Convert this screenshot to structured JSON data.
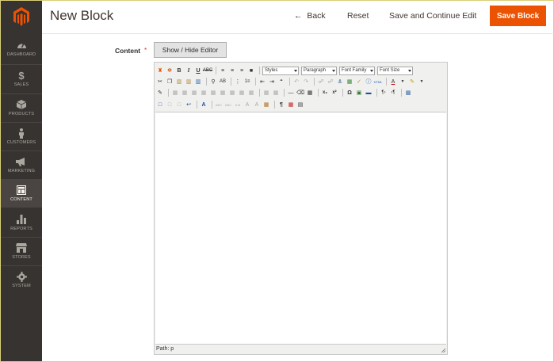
{
  "sidebar": {
    "items": [
      {
        "label": "DASHBOARD",
        "icon": "dashboard-icon"
      },
      {
        "label": "SALES",
        "icon": "dollar-icon"
      },
      {
        "label": "PRODUCTS",
        "icon": "box-icon"
      },
      {
        "label": "CUSTOMERS",
        "icon": "person-icon"
      },
      {
        "label": "MARKETING",
        "icon": "megaphone-icon"
      },
      {
        "label": "CONTENT",
        "icon": "layout-icon",
        "active": true
      },
      {
        "label": "REPORTS",
        "icon": "bar-chart-icon"
      },
      {
        "label": "STORES",
        "icon": "store-icon"
      },
      {
        "label": "SYSTEM",
        "icon": "gear-icon"
      }
    ]
  },
  "header": {
    "title": "New Block",
    "back": "Back",
    "reset": "Reset",
    "save_continue": "Save and Continue Edit",
    "save": "Save Block"
  },
  "form": {
    "content_label": "Content",
    "required_mark": "*",
    "toggle_editor": "Show / Hide Editor"
  },
  "editor": {
    "styles": "Styles",
    "paragraph": "Paragraph",
    "font_family": "Font Family",
    "font_size": "Font Size",
    "path": "Path: p"
  },
  "colors": {
    "sidebar_bg": "#373330",
    "accent": "#eb5202"
  }
}
